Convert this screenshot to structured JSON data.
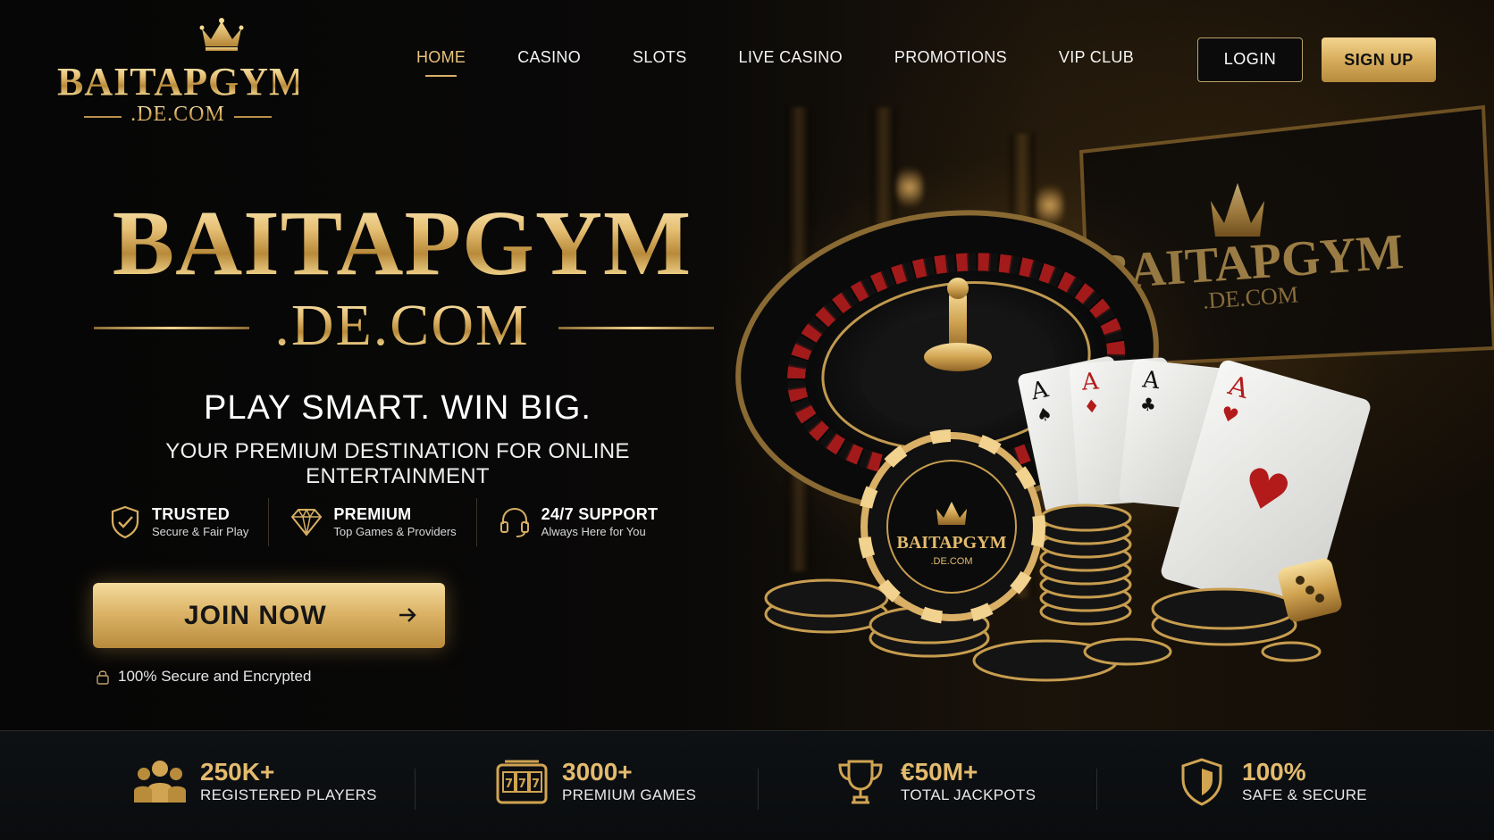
{
  "logo": {
    "name": "BAITAPGYM",
    "domain": ".DE.COM"
  },
  "nav": {
    "items": [
      {
        "label": "HOME",
        "active": true
      },
      {
        "label": "CASINO"
      },
      {
        "label": "SLOTS"
      },
      {
        "label": "LIVE CASINO"
      },
      {
        "label": "PROMOTIONS"
      },
      {
        "label": "VIP CLUB"
      }
    ],
    "login_label": "LOGIN",
    "signup_label": "SIGN UP"
  },
  "hero": {
    "title": "BAITAPGYM",
    "domain": ".DE.COM",
    "tagline": "PLAY SMART. WIN BIG.",
    "subline": "YOUR PREMIUM DESTINATION FOR ONLINE ENTERTAINMENT",
    "features": [
      {
        "title": "TRUSTED",
        "sub": "Secure & Fair Play",
        "icon": "shield-check-icon"
      },
      {
        "title": "PREMIUM",
        "sub": "Top Games & Providers",
        "icon": "diamond-icon"
      },
      {
        "title": "24/7 SUPPORT",
        "sub": "Always Here for You",
        "icon": "headset-icon"
      }
    ],
    "cta_label": "JOIN NOW",
    "secure_note": "100% Secure and Encrypted"
  },
  "art": {
    "sign_name": "BAITAPGYM",
    "sign_domain": ".DE.COM",
    "chip_name": "BAITAPGYM",
    "chip_domain": ".DE.COM"
  },
  "stats": [
    {
      "value": "250K+",
      "label": "REGISTERED PLAYERS",
      "icon": "users-icon"
    },
    {
      "value": "3000+",
      "label": "PREMIUM GAMES",
      "icon": "slot-machine-icon"
    },
    {
      "value": "€50M+",
      "label": "TOTAL JACKPOTS",
      "icon": "trophy-icon"
    },
    {
      "value": "100%",
      "label": "SAFE & SECURE",
      "icon": "shield-icon"
    }
  ],
  "colors": {
    "gold": "#e3bb6e",
    "background": "#050505",
    "stats_bg": "#0e1114"
  }
}
